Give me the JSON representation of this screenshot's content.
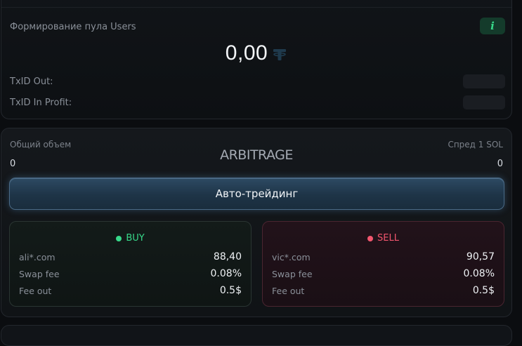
{
  "pool": {
    "label": "Формирование пула Users",
    "info_label": "i",
    "amount": "0,00",
    "currency_icon": "tether-icon",
    "txid_out_label": "TxID Out:",
    "txid_in_profit_label": "TxID In Profit:"
  },
  "arbitrage": {
    "title": "ARBITRAGE",
    "volume_label": "Общий объем",
    "volume_value": "0",
    "spread_label": "Спред 1 SOL",
    "spread_value": "0",
    "auto_trading_label": "Авто-трейдинг"
  },
  "buy": {
    "title": "BUY",
    "exchange": "ali*.com",
    "price": "88,40",
    "swap_fee_label": "Swap fee",
    "swap_fee": "0.08%",
    "fee_out_label": "Fee out",
    "fee_out": "0.5$"
  },
  "sell": {
    "title": "SELL",
    "exchange": "vic*.com",
    "price": "90,57",
    "swap_fee_label": "Swap fee",
    "swap_fee": "0.08%",
    "fee_out_label": "Fee out",
    "fee_out": "0.5$"
  },
  "colors": {
    "buy_accent": "#37d98a",
    "sell_accent": "#f2566e",
    "button_accent": "#2d4a63"
  }
}
